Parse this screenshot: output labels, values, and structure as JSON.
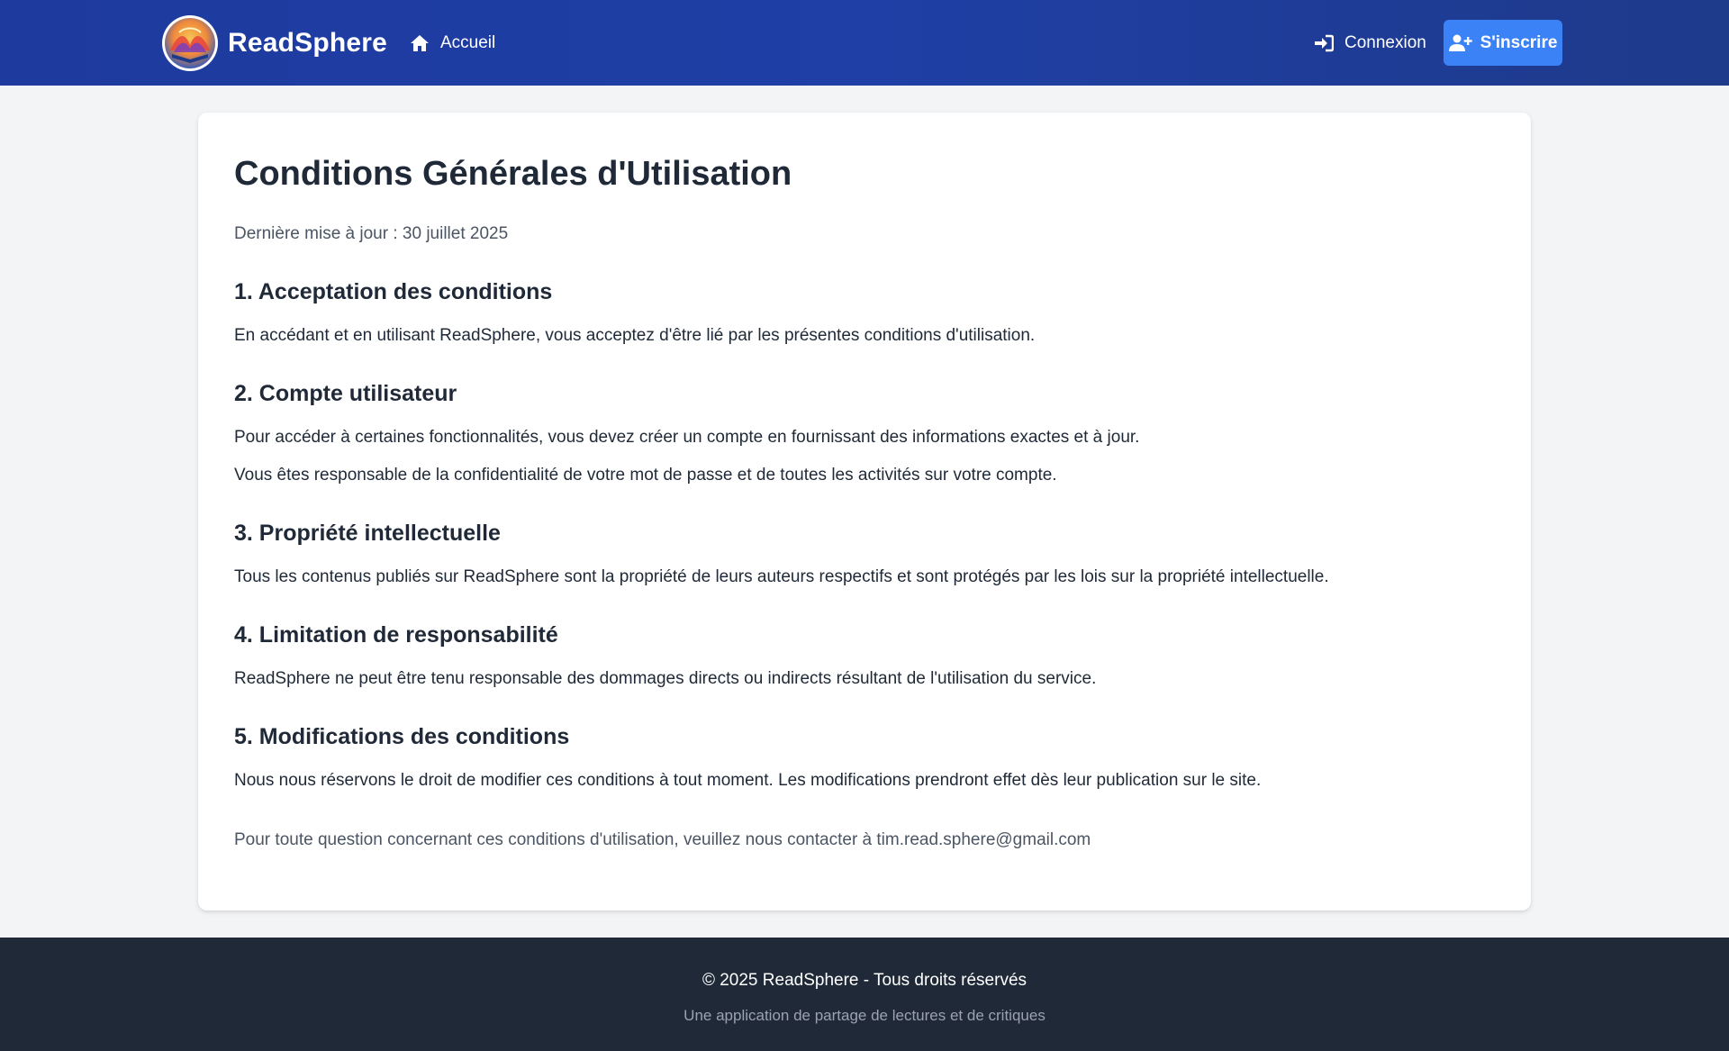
{
  "header": {
    "brand": "ReadSphere",
    "nav_home": "Accueil",
    "login": "Connexion",
    "signup": "S'inscrire",
    "home_icon": "home-icon",
    "login_icon": "sign-in-icon",
    "signup_icon": "user-plus-icon",
    "colors": {
      "navbar": "#1e3a9e",
      "signup_button": "#3b82f6"
    }
  },
  "main": {
    "title": "Conditions Générales d'Utilisation",
    "last_updated": "Dernière mise à jour : 30 juillet 2025",
    "sections": [
      {
        "heading": "1. Acceptation des conditions",
        "paragraphs": [
          "En accédant et en utilisant ReadSphere, vous acceptez d'être lié par les présentes conditions d'utilisation."
        ]
      },
      {
        "heading": "2. Compte utilisateur",
        "paragraphs": [
          "Pour accéder à certaines fonctionnalités, vous devez créer un compte en fournissant des informations exactes et à jour.",
          "Vous êtes responsable de la confidentialité de votre mot de passe et de toutes les activités sur votre compte."
        ]
      },
      {
        "heading": "3. Propriété intellectuelle",
        "paragraphs": [
          "Tous les contenus publiés sur ReadSphere sont la propriété de leurs auteurs respectifs et sont protégés par les lois sur la propriété intellectuelle."
        ]
      },
      {
        "heading": "4. Limitation de responsabilité",
        "paragraphs": [
          "ReadSphere ne peut être tenu responsable des dommages directs ou indirects résultant de l'utilisation du service."
        ]
      },
      {
        "heading": "5. Modifications des conditions",
        "paragraphs": [
          "Nous nous réservons le droit de modifier ces conditions à tout moment. Les modifications prendront effet dès leur publication sur le site."
        ]
      }
    ],
    "contact": "Pour toute question concernant ces conditions d'utilisation, veuillez nous contacter à tim.read.sphere@gmail.com"
  },
  "footer": {
    "copyright": "© 2025 ReadSphere - Tous droits réservés",
    "tagline": "Une application de partage de lectures et de critiques"
  }
}
